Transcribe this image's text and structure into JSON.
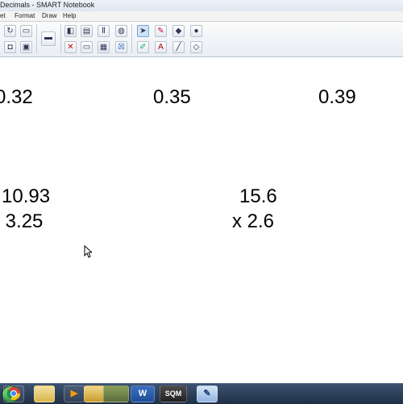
{
  "window": {
    "title": "Decimals - SMART Notebook"
  },
  "menu": {
    "items": [
      "et",
      "Format",
      "Draw",
      "Help"
    ]
  },
  "toolbar": {
    "icons": [
      "redo-icon",
      "open-folder-icon",
      "save-icon",
      "screen-capture-icon",
      "display-icon",
      "full-screen-icon",
      "table-icon",
      "delete-icon",
      "gallery-icon",
      "select-arrow-icon",
      "pen-icon",
      "eraser-icon",
      "fill-icon",
      "magic-pen-icon",
      "text-icon",
      "line-icon",
      "shape-icon"
    ]
  },
  "canvas": {
    "problems_row1": [
      "0.32",
      "0.35",
      "0.39"
    ],
    "problem_add": {
      "top": "10.93",
      "bottom": "+ 3.25"
    },
    "problem_mult": {
      "top": "15.6",
      "bottom": "x 2.6"
    }
  },
  "taskbar": {
    "items": [
      "start-button",
      "chrome-icon",
      "file-explorer-icon",
      "media-player-icon",
      "folder-icon",
      "landscape-image-icon",
      "word-icon",
      "scene-icon",
      "smart-notebook-icon"
    ],
    "word_label": "W",
    "brand_label": "SQM"
  }
}
